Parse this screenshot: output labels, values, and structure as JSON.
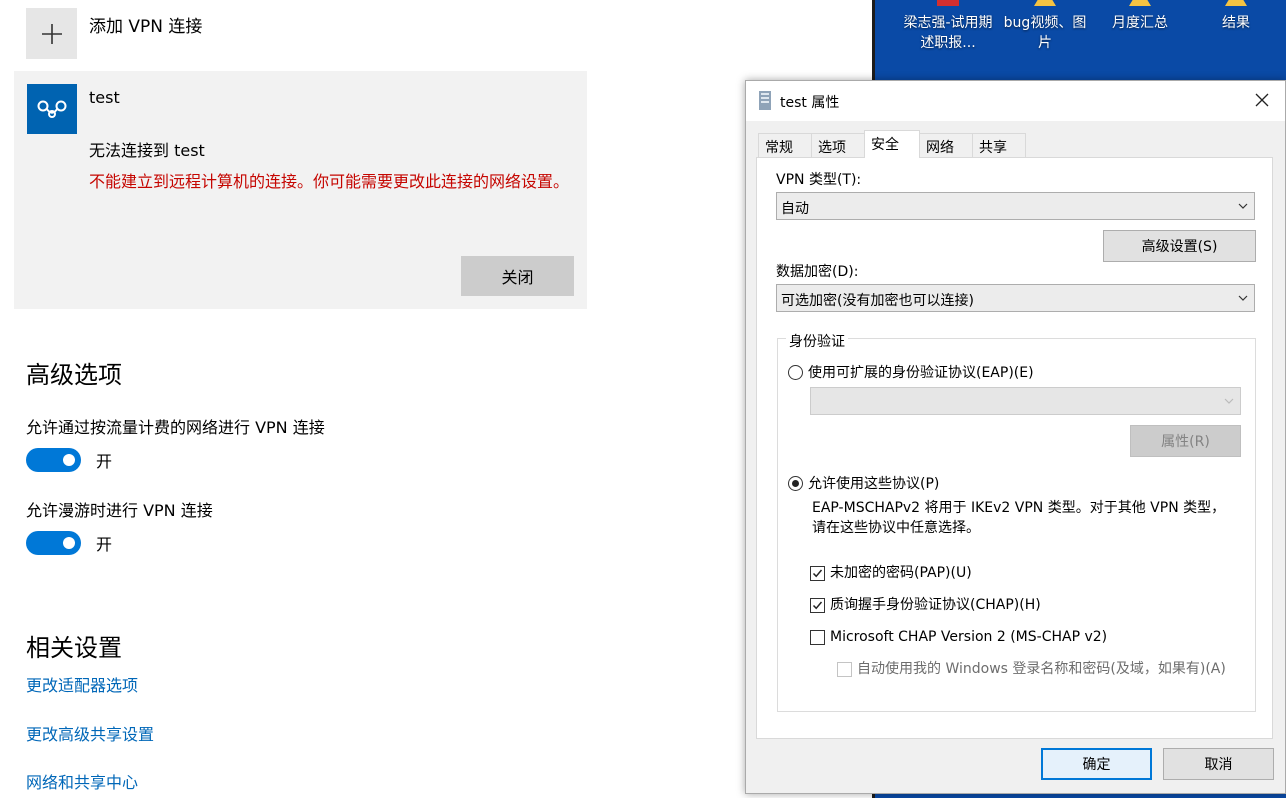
{
  "settings": {
    "add_vpn_label": "添加 VPN 连接",
    "vpn": {
      "name": "test",
      "status": "无法连接到 test",
      "error": "不能建立到远程计算机的连接。你可能需要更改此连接的网络设置。",
      "close_label": "关闭"
    },
    "advanced_heading": "高级选项",
    "metered_label": "允许通过按流量计费的网络进行 VPN 连接",
    "metered_state": "开",
    "roaming_label": "允许漫游时进行 VPN 连接",
    "roaming_state": "开",
    "related_heading": "相关设置",
    "links": [
      "更改适配器选项",
      "更改高级共享设置",
      "网络和共享中心"
    ]
  },
  "desktop": {
    "icons": [
      {
        "label": "梁志强-试用期述职报...",
        "icon": "document-icon"
      },
      {
        "label": "bug视频、图片",
        "icon": "folder-icon"
      },
      {
        "label": "月度汇总",
        "icon": "folder-icon"
      },
      {
        "label": "结果",
        "icon": "folder-icon"
      }
    ]
  },
  "dialog": {
    "title": "test 属性",
    "tabs": [
      "常规",
      "选项",
      "安全",
      "网络",
      "共享"
    ],
    "active_tab": "安全",
    "vpn_type_label": "VPN 类型(T):",
    "vpn_type_value": "自动",
    "advanced_button": "高级设置(S)",
    "encryption_label": "数据加密(D):",
    "encryption_value": "可选加密(没有加密也可以连接)",
    "auth_group_title": "身份验证",
    "eap_radio_label": "使用可扩展的身份验证协议(EAP)(E)",
    "eap_select_value": "",
    "properties_button": "属性(R)",
    "protocols_radio_label": "允许使用这些协议(P)",
    "protocols_note": "EAP-MSCHAPv2 将用于 IKEv2 VPN 类型。对于其他 VPN 类型，请在这些协议中任意选择。",
    "pap_label": "未加密的密码(PAP)(U)",
    "chap_label": "质询握手身份验证协议(CHAP)(H)",
    "mschap_label": "Microsoft CHAP Version 2 (MS-CHAP v2)",
    "autologon_label": "自动使用我的 Windows 登录名称和密码(及域，如果有)(A)",
    "ok_button": "确定",
    "cancel_button": "取消"
  },
  "colors": {
    "accent": "#0078d7",
    "error": "#c50500",
    "link": "#0067b8",
    "desktop": "#0a4aa6"
  }
}
